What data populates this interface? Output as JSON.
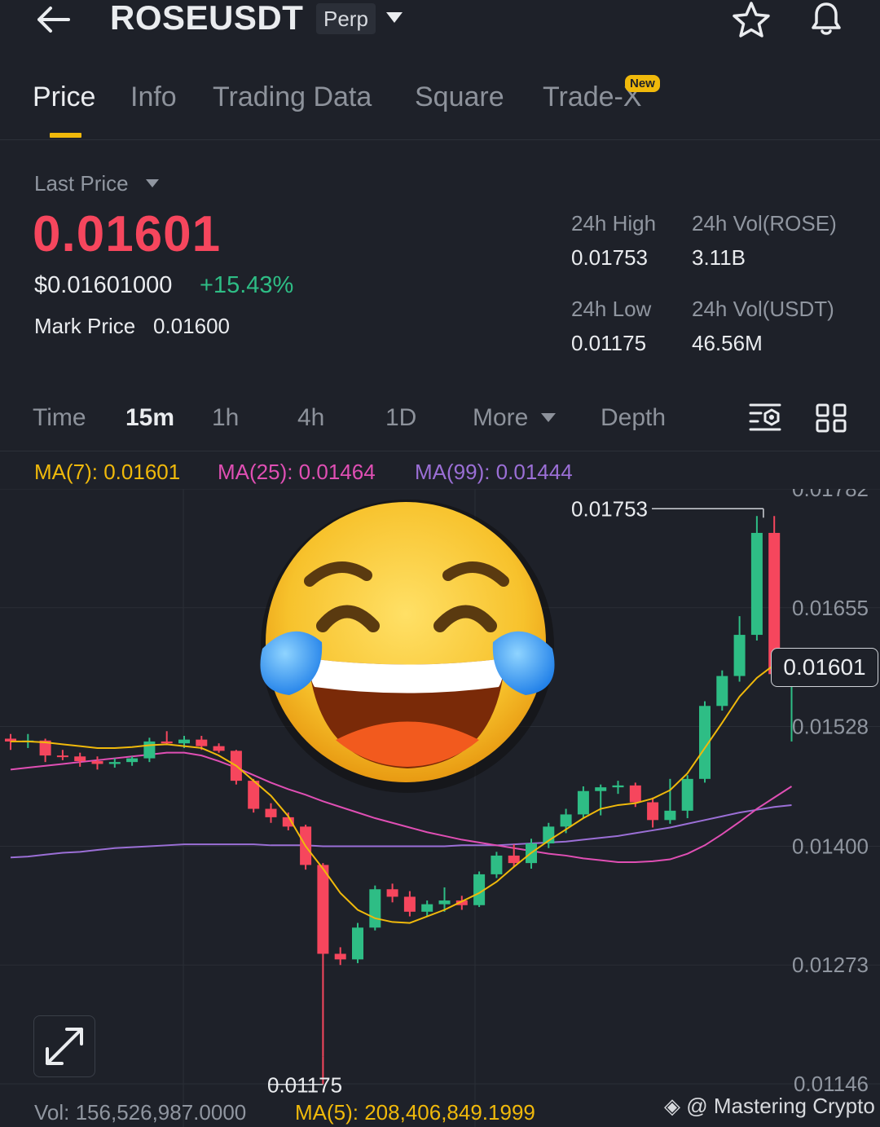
{
  "header": {
    "symbol": "ROSEUSDT",
    "contract_type": "Perp"
  },
  "tabs": [
    {
      "label": "Price",
      "active": true
    },
    {
      "label": "Info"
    },
    {
      "label": "Trading Data"
    },
    {
      "label": "Square"
    },
    {
      "label": "Trade-X",
      "badge": "New"
    }
  ],
  "price": {
    "last_price_label": "Last Price",
    "last_price": "0.01601",
    "usd_price": "$0.01601000",
    "change_pct": "+15.43%",
    "mark_price_label": "Mark Price",
    "mark_price": "0.01600"
  },
  "stats": {
    "high_label": "24h High",
    "high": "0.01753",
    "vol_base_label": "24h Vol(ROSE)",
    "vol_base": "3.11B",
    "low_label": "24h Low",
    "low": "0.01175",
    "vol_quote_label": "24h Vol(USDT)",
    "vol_quote": "46.56M"
  },
  "intervals": {
    "time": "Time",
    "m15": "15m",
    "h1": "1h",
    "h4": "4h",
    "d1": "1D",
    "more": "More",
    "depth": "Depth",
    "active": "15m"
  },
  "indicators": {
    "ma7": "MA(7): 0.01601",
    "ma25": "MA(25): 0.01464",
    "ma99": "MA(99): 0.01444"
  },
  "chart_data": {
    "type": "candlestick",
    "y_axis_ticks": [
      "0.01782",
      "0.01655",
      "0.01528",
      "0.01400",
      "0.01273",
      "0.01146"
    ],
    "ylim": [
      0.01146,
      0.01782
    ],
    "high_marker": "0.01753",
    "low_marker": "0.01175",
    "current_price": "0.01601",
    "candles": [
      {
        "o": 0.01515,
        "h": 0.0152,
        "l": 0.01503,
        "c": 0.01512
      },
      {
        "o": 0.01512,
        "h": 0.0152,
        "l": 0.01505,
        "c": 0.01513
      },
      {
        "o": 0.01513,
        "h": 0.01515,
        "l": 0.0149,
        "c": 0.01497
      },
      {
        "o": 0.01497,
        "h": 0.01503,
        "l": 0.01492,
        "c": 0.01496
      },
      {
        "o": 0.01496,
        "h": 0.015,
        "l": 0.01485,
        "c": 0.01491
      },
      {
        "o": 0.01491,
        "h": 0.01496,
        "l": 0.01482,
        "c": 0.01488
      },
      {
        "o": 0.01488,
        "h": 0.01494,
        "l": 0.01484,
        "c": 0.0149
      },
      {
        "o": 0.0149,
        "h": 0.01496,
        "l": 0.01486,
        "c": 0.01494
      },
      {
        "o": 0.01494,
        "h": 0.01516,
        "l": 0.0149,
        "c": 0.01512
      },
      {
        "o": 0.01512,
        "h": 0.01523,
        "l": 0.01508,
        "c": 0.0151
      },
      {
        "o": 0.0151,
        "h": 0.01518,
        "l": 0.01505,
        "c": 0.01514
      },
      {
        "o": 0.01514,
        "h": 0.01518,
        "l": 0.01503,
        "c": 0.01507
      },
      {
        "o": 0.01507,
        "h": 0.0151,
        "l": 0.015,
        "c": 0.01502
      },
      {
        "o": 0.01502,
        "h": 0.01503,
        "l": 0.01466,
        "c": 0.0147
      },
      {
        "o": 0.0147,
        "h": 0.01472,
        "l": 0.01436,
        "c": 0.0144
      },
      {
        "o": 0.0144,
        "h": 0.01446,
        "l": 0.01425,
        "c": 0.01431
      },
      {
        "o": 0.01431,
        "h": 0.01436,
        "l": 0.01417,
        "c": 0.01421
      },
      {
        "o": 0.01421,
        "h": 0.01423,
        "l": 0.01375,
        "c": 0.0138
      },
      {
        "o": 0.0138,
        "h": 0.01382,
        "l": 0.01175,
        "c": 0.01285
      },
      {
        "o": 0.01285,
        "h": 0.01292,
        "l": 0.01273,
        "c": 0.01279
      },
      {
        "o": 0.01279,
        "h": 0.01318,
        "l": 0.01275,
        "c": 0.01313
      },
      {
        "o": 0.01313,
        "h": 0.01358,
        "l": 0.0131,
        "c": 0.01354
      },
      {
        "o": 0.01354,
        "h": 0.0136,
        "l": 0.0134,
        "c": 0.01346
      },
      {
        "o": 0.01346,
        "h": 0.01352,
        "l": 0.01325,
        "c": 0.0133
      },
      {
        "o": 0.0133,
        "h": 0.01342,
        "l": 0.01325,
        "c": 0.01338
      },
      {
        "o": 0.01338,
        "h": 0.01356,
        "l": 0.0133,
        "c": 0.01342
      },
      {
        "o": 0.01342,
        "h": 0.01347,
        "l": 0.01332,
        "c": 0.01337
      },
      {
        "o": 0.01337,
        "h": 0.01373,
        "l": 0.01335,
        "c": 0.0137
      },
      {
        "o": 0.0137,
        "h": 0.01394,
        "l": 0.01366,
        "c": 0.0139
      },
      {
        "o": 0.0139,
        "h": 0.01402,
        "l": 0.01378,
        "c": 0.01382
      },
      {
        "o": 0.01382,
        "h": 0.01408,
        "l": 0.01376,
        "c": 0.01403
      },
      {
        "o": 0.01403,
        "h": 0.01425,
        "l": 0.01398,
        "c": 0.01421
      },
      {
        "o": 0.01421,
        "h": 0.0144,
        "l": 0.01414,
        "c": 0.01434
      },
      {
        "o": 0.01434,
        "h": 0.01464,
        "l": 0.0143,
        "c": 0.01459
      },
      {
        "o": 0.01459,
        "h": 0.01466,
        "l": 0.01433,
        "c": 0.01463
      },
      {
        "o": 0.01463,
        "h": 0.0147,
        "l": 0.01456,
        "c": 0.01465
      },
      {
        "o": 0.01465,
        "h": 0.01468,
        "l": 0.01442,
        "c": 0.01447
      },
      {
        "o": 0.01447,
        "h": 0.01452,
        "l": 0.0142,
        "c": 0.01428
      },
      {
        "o": 0.01428,
        "h": 0.01472,
        "l": 0.01424,
        "c": 0.01438
      },
      {
        "o": 0.01438,
        "h": 0.01476,
        "l": 0.0143,
        "c": 0.01472
      },
      {
        "o": 0.01472,
        "h": 0.01555,
        "l": 0.01468,
        "c": 0.0155
      },
      {
        "o": 0.0155,
        "h": 0.01588,
        "l": 0.01545,
        "c": 0.01582
      },
      {
        "o": 0.01582,
        "h": 0.01646,
        "l": 0.01576,
        "c": 0.01626
      },
      {
        "o": 0.01626,
        "h": 0.01753,
        "l": 0.0162,
        "c": 0.01735
      },
      {
        "o": 0.01735,
        "h": 0.01753,
        "l": 0.01578,
        "c": 0.01584
      },
      {
        "o": 0.01584,
        "h": 0.01606,
        "l": 0.01512,
        "c": 0.01601
      }
    ],
    "ma7": [
      0.01512,
      0.01512,
      0.01511,
      0.01509,
      0.01507,
      0.01505,
      0.01505,
      0.01506,
      0.01508,
      0.01509,
      0.01507,
      0.01505,
      0.01497,
      0.01486,
      0.0147,
      0.01454,
      0.01432,
      0.014,
      0.01376,
      0.0135,
      0.01332,
      0.01323,
      0.01319,
      0.01318,
      0.01325,
      0.01332,
      0.01341,
      0.0135,
      0.01362,
      0.01378,
      0.01393,
      0.01406,
      0.01418,
      0.0143,
      0.0144,
      0.01444,
      0.01446,
      0.01451,
      0.0146,
      0.01478,
      0.01505,
      0.01532,
      0.0156,
      0.0158,
      0.01594,
      0.01601
    ],
    "ma25": [
      0.01482,
      0.01484,
      0.01486,
      0.01488,
      0.0149,
      0.01492,
      0.01494,
      0.01496,
      0.01498,
      0.015,
      0.015,
      0.01497,
      0.01491,
      0.01484,
      0.01476,
      0.01468,
      0.01461,
      0.01455,
      0.01448,
      0.01442,
      0.01436,
      0.0143,
      0.01425,
      0.0142,
      0.01415,
      0.01411,
      0.01407,
      0.01404,
      0.01401,
      0.01398,
      0.01395,
      0.01392,
      0.0139,
      0.01387,
      0.01385,
      0.01383,
      0.01383,
      0.01384,
      0.01386,
      0.01392,
      0.01401,
      0.01413,
      0.01426,
      0.0144,
      0.01452,
      0.01464
    ],
    "ma99": [
      0.01388,
      0.01389,
      0.01391,
      0.01393,
      0.01394,
      0.01396,
      0.01398,
      0.01399,
      0.014,
      0.01401,
      0.01402,
      0.01402,
      0.01402,
      0.01402,
      0.01402,
      0.01401,
      0.01401,
      0.01401,
      0.014,
      0.014,
      0.014,
      0.014,
      0.014,
      0.014,
      0.014,
      0.014,
      0.01401,
      0.01401,
      0.01401,
      0.01402,
      0.01403,
      0.01404,
      0.01405,
      0.01407,
      0.01409,
      0.01411,
      0.01414,
      0.01417,
      0.0142,
      0.01424,
      0.01428,
      0.01432,
      0.01436,
      0.01439,
      0.01442,
      0.01444
    ]
  },
  "footer": {
    "volume": "Vol: 156,526,987.0000",
    "volume_ma": "MA(5): 208,406,849.1999",
    "watermark": "@ Mastering Crypto"
  },
  "colors": {
    "up": "#2ebd85",
    "down": "#f6465d",
    "ma7": "#f0b90b",
    "ma25": "#e04fb4",
    "ma99": "#9b6fd6",
    "accent": "#f0b90b"
  }
}
